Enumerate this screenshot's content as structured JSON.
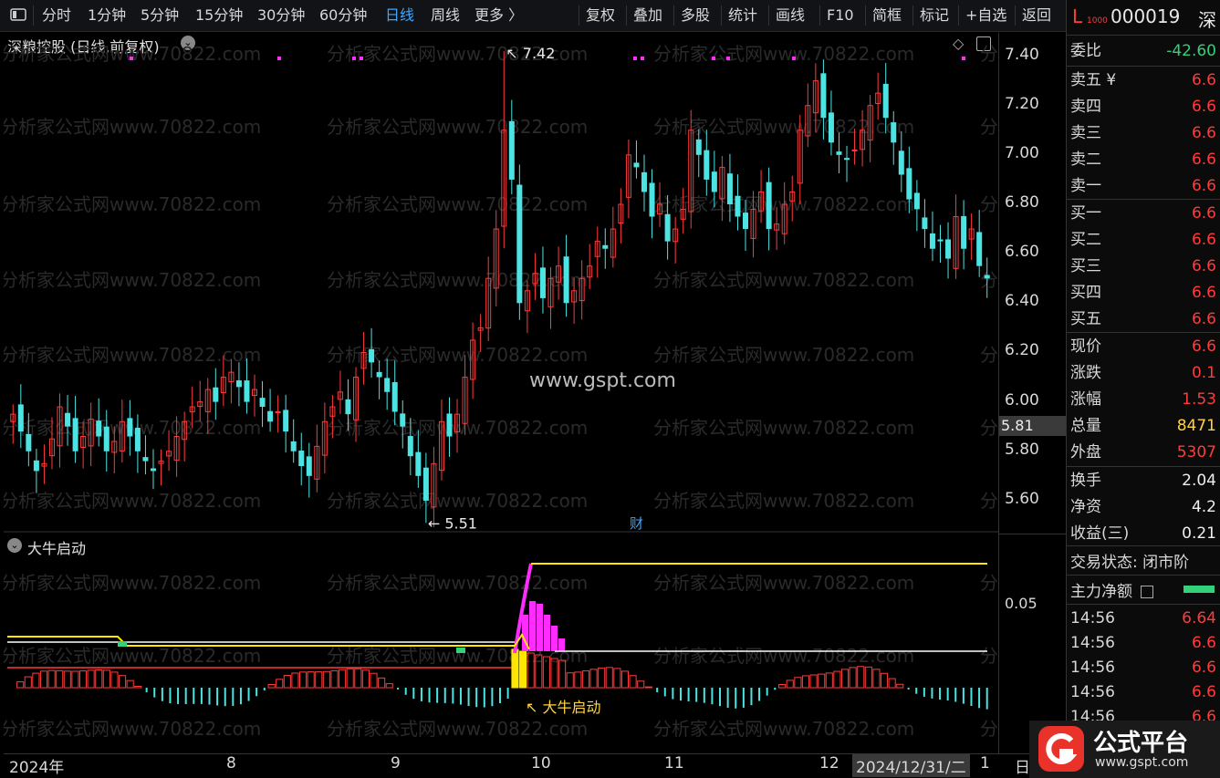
{
  "toolbar": {
    "tabs": [
      "分时",
      "1分钟",
      "5分钟",
      "15分钟",
      "30分钟",
      "60分钟",
      "日线",
      "周线",
      "更多 〉"
    ],
    "active_tab": "日线",
    "actions": [
      "复权",
      "叠加",
      "多股",
      "统计",
      "画线",
      "F10",
      "简框",
      "标记",
      "+自选",
      "返回"
    ]
  },
  "chart": {
    "title": "深粮控股 (日线,前复权)",
    "high_label": "7.42",
    "low_label": "5.51",
    "watermark": "www.gspt.com",
    "watermark_repeat": "分析家公式网www.70822.com",
    "cai_marker": "财",
    "price_ticks": [
      "7.40",
      "7.20",
      "7.00",
      "6.80",
      "6.60",
      "6.40",
      "6.20",
      "6.00",
      "5.80",
      "5.60"
    ],
    "current_price_box": "5.81"
  },
  "indicator": {
    "title": "大牛启动",
    "tick": "0.05",
    "annotation": "大牛启动"
  },
  "date_axis": {
    "labels": [
      "2024年",
      "8",
      "9",
      "10",
      "11",
      "12",
      "2024/12/31/二",
      "1",
      "日"
    ]
  },
  "quote": {
    "code_prefix": "L",
    "code_sub": "1000",
    "code": "000019",
    "market": "深",
    "weibi_label": "委比",
    "weibi_value": "-42.60",
    "asks": [
      {
        "label": "卖五 ¥",
        "value": "6.6"
      },
      {
        "label": "卖四",
        "value": "6.6"
      },
      {
        "label": "卖三",
        "value": "6.6"
      },
      {
        "label": "卖二",
        "value": "6.6"
      },
      {
        "label": "卖一",
        "value": "6.6"
      }
    ],
    "bids": [
      {
        "label": "买一",
        "value": "6.6"
      },
      {
        "label": "买二",
        "value": "6.6"
      },
      {
        "label": "买三",
        "value": "6.6"
      },
      {
        "label": "买四",
        "value": "6.6"
      },
      {
        "label": "买五",
        "value": "6.6"
      }
    ],
    "stats": [
      {
        "label": "现价",
        "value": "6.6",
        "color": "red"
      },
      {
        "label": "涨跌",
        "value": "0.1",
        "color": "red"
      },
      {
        "label": "涨幅",
        "value": "1.53",
        "color": "red"
      },
      {
        "label": "总量",
        "value": "8471",
        "color": "yellow"
      },
      {
        "label": "外盘",
        "value": "5307",
        "color": "red"
      },
      {
        "label": "换手",
        "value": "2.04",
        "color": "white"
      },
      {
        "label": "净资",
        "value": "4.2",
        "color": "white"
      },
      {
        "label": "收益(三)",
        "value": "0.21",
        "color": "white"
      }
    ],
    "trade_status_label": "交易状态:",
    "trade_status_value": "闭市阶",
    "main_net_label": "主力净额",
    "ticks": [
      {
        "time": "14:56",
        "price": "6.64"
      },
      {
        "time": "14:56",
        "price": "6.6"
      },
      {
        "time": "14:56",
        "price": "6.6"
      },
      {
        "time": "14:56",
        "price": "6.6"
      },
      {
        "time": "14:56",
        "price": "6.6"
      }
    ]
  },
  "brand": {
    "name": "公式平台",
    "url": "www.gspt.com"
  },
  "colors": {
    "up": "#ff3b3b",
    "down": "#4de3e3",
    "accent": "#3fa6ff",
    "magenta": "#ff2bff",
    "yellow": "#ffe600"
  },
  "chart_data": {
    "type": "candlestick",
    "title": "深粮控股 (日线,前复权)",
    "ylim": [
      5.5,
      7.45
    ],
    "x_labels": [
      "2024年",
      "8",
      "9",
      "10",
      "11",
      "12",
      "2024/12/31/二",
      "1"
    ],
    "series": [
      {
        "name": "close",
        "values": [
          5.95,
          5.88,
          5.8,
          5.72,
          5.75,
          5.85,
          5.98,
          5.9,
          5.8,
          5.86,
          5.93,
          5.86,
          5.8,
          5.84,
          5.92,
          5.86,
          5.8,
          5.76,
          5.72,
          5.76,
          5.8,
          5.86,
          5.92,
          5.98,
          6.0,
          6.05,
          6.0,
          6.1,
          6.12,
          6.06,
          6.0,
          6.05,
          5.98,
          5.92,
          5.96,
          5.88,
          5.8,
          5.74,
          5.7,
          5.82,
          5.92,
          5.98,
          6.04,
          5.95,
          6.1,
          6.2,
          6.16,
          6.1,
          6.04,
          5.96,
          5.9,
          5.78,
          5.7,
          5.6,
          5.75,
          5.92,
          5.86,
          5.95,
          6.1,
          6.25,
          6.3,
          6.5,
          6.7,
          7.1,
          6.9,
          6.4,
          6.45,
          6.52,
          6.42,
          6.5,
          6.55,
          6.4,
          6.45,
          6.5,
          6.55,
          6.65,
          6.62,
          6.7,
          6.8,
          7.0,
          6.95,
          6.85,
          6.75,
          6.8,
          6.65,
          6.7,
          6.78,
          7.1,
          7.0,
          6.9,
          6.85,
          6.95,
          6.8,
          6.75,
          6.7,
          6.78,
          6.85,
          6.7,
          6.72,
          6.8,
          6.85,
          7.1,
          7.2,
          7.3,
          7.15,
          7.05,
          7.0,
          6.98,
          7.02,
          7.1,
          7.2,
          7.25,
          7.15,
          7.05,
          6.92,
          6.82,
          6.78,
          6.7,
          6.62,
          6.65,
          6.58,
          6.75,
          6.62,
          6.7,
          6.55,
          6.5
        ]
      }
    ],
    "high": 7.42,
    "low": 5.51,
    "indicator": {
      "name": "大牛启动",
      "ylim": [
        -0.03,
        0.07
      ],
      "ticks": [
        0.05
      ]
    }
  }
}
